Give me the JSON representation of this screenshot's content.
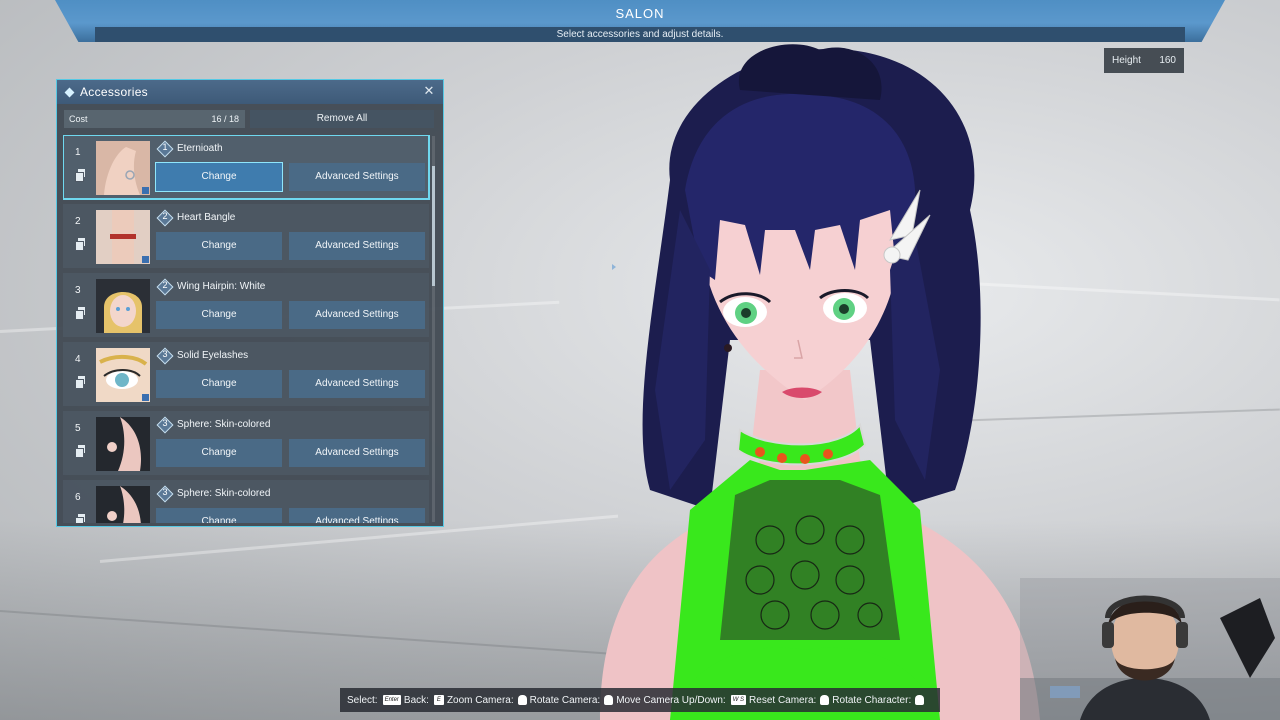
{
  "header": {
    "title": "SALON",
    "subtitle": "Select accessories and adjust details."
  },
  "height_badge": {
    "label": "Height",
    "value": "160"
  },
  "panel": {
    "title": "Accessories",
    "close_icon": "close-icon",
    "cost_label": "Cost",
    "cost_value": "16 / 18",
    "remove_all_label": "Remove All",
    "items": [
      {
        "index": "1",
        "cost": "1",
        "name": "Eternioath",
        "thumb": "hand-ring",
        "change_label": "Change",
        "advanced_label": "Advanced Settings",
        "selected": true
      },
      {
        "index": "2",
        "cost": "2",
        "name": "Heart Bangle",
        "thumb": "wrist-bangle",
        "change_label": "Change",
        "advanced_label": "Advanced Settings",
        "selected": false
      },
      {
        "index": "3",
        "cost": "2",
        "name": "Wing Hairpin: White",
        "thumb": "blonde-head",
        "change_label": "Change",
        "advanced_label": "Advanced Settings",
        "selected": false
      },
      {
        "index": "4",
        "cost": "3",
        "name": "Solid Eyelashes",
        "thumb": "eye-closeup",
        "change_label": "Change",
        "advanced_label": "Advanced Settings",
        "selected": false
      },
      {
        "index": "5",
        "cost": "3",
        "name": "Sphere: Skin-colored",
        "thumb": "body-sphere",
        "change_label": "Change",
        "advanced_label": "Advanced Settings",
        "selected": false
      },
      {
        "index": "6",
        "cost": "3",
        "name": "Sphere: Skin-colored",
        "thumb": "body-sphere",
        "change_label": "Change",
        "advanced_label": "Advanced Settings",
        "selected": false
      }
    ]
  },
  "controls_hint": {
    "select": "Select:",
    "back": "Back:",
    "zoom_camera": "Zoom Camera:",
    "rotate_camera": "Rotate Camera:",
    "move_camera": "Move Camera Up/Down:",
    "reset_camera": "Reset Camera:",
    "rotate_character": "Rotate Character:",
    "key_enter": "Enter",
    "key_e": "E",
    "key_ws": "W S"
  },
  "colors": {
    "accent": "#56c9e4",
    "header_blue": "#4f8fc4",
    "panel_bg": "#3c444e",
    "hair": "#1c1d4e",
    "outfit_green": "#39e81c"
  }
}
